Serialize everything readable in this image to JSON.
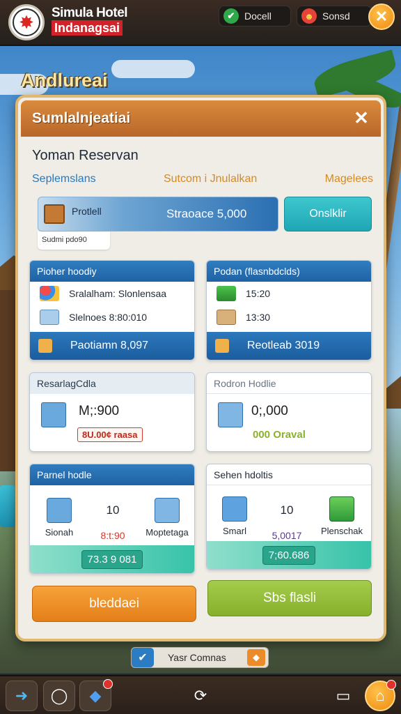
{
  "header": {
    "brand_line1": "Simula Hotel",
    "brand_line2": "Indanagsai",
    "pill_left_label": "Docell",
    "pill_right_label": "Sonsd",
    "close_icon": "close-icon"
  },
  "scene": {
    "title": "Andlureai"
  },
  "dialog": {
    "title": "Sumlalnjeatiai",
    "reservation_title": "Yoman Reservan",
    "tabs": [
      "Seplemslans",
      "Sutcom i Jnulalkan",
      "Magelees"
    ],
    "price_bar": {
      "label": "Protlell",
      "value": "Straoace  5,000"
    },
    "sub_note": "Sudmi  pdo90",
    "confirm_button": "Onslklir",
    "card_hotel": {
      "header": "Pioher hoodiy",
      "rows": [
        "Sralalham: Slonlensaa",
        "Slelnoes 8:80:010"
      ],
      "footer": "Paotiamn  8,097"
    },
    "card_time": {
      "header": "Podan (flasnbdclds)",
      "rows": [
        "15:20",
        "13:30"
      ],
      "footer": "Reotleab 3019"
    },
    "card_reserv": {
      "header": "ResarlagCdla",
      "value": "M;:900",
      "tag": "8U.00¢ raasa"
    },
    "card_rodn": {
      "header": "Rodron Hodlie",
      "value": "0;,000",
      "tag": "000 Oraval"
    },
    "card_room_left": {
      "header": "Parnel hodle",
      "cols": [
        {
          "label": "Sionah",
          "value": ""
        },
        {
          "label": "8:t:90",
          "value": "10"
        },
        {
          "label": "Moptetaga",
          "value": ""
        }
      ],
      "chip": "73.3 9 081"
    },
    "card_room_right": {
      "header": "Sehen hdoltis",
      "cols": [
        {
          "label": "Smarl",
          "value": ""
        },
        {
          "label": "5,0017",
          "value": "10"
        },
        {
          "label": "Plenschak",
          "value": ""
        }
      ],
      "chip": "7;60.686"
    },
    "button_orange": "bleddaei",
    "button_green": "Sbs flasli"
  },
  "status_chip": {
    "label": "Yasr Comnas"
  },
  "colors": {
    "accent_orange": "#e57f18",
    "accent_blue": "#1f62a4",
    "accent_teal": "#1ea6b4",
    "accent_green": "#86b02c",
    "header_brown": "#b9662a"
  }
}
